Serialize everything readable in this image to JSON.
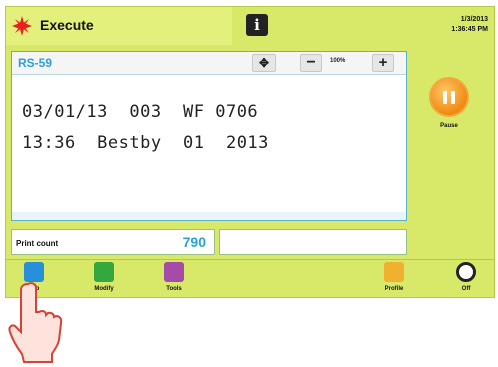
{
  "header": {
    "title": "Execute",
    "info_icon": "info-icon",
    "info_glyph": "i",
    "date": "1/3/2013",
    "time": "1:36:45 PM"
  },
  "editor": {
    "job_name": "RS-59",
    "zoom": "100%",
    "minus_glyph": "−",
    "plus_glyph": "+",
    "move_glyph": "✥",
    "message_lines": [
      "03/01/13  003  WF 0706",
      "13:36  Bestby  01  2013"
    ]
  },
  "pause": {
    "label": "Pause"
  },
  "print_count": {
    "label": "Print count",
    "value": "790"
  },
  "nav": [
    {
      "label": "Job",
      "icon": "job-icon"
    },
    {
      "label": "Modify",
      "icon": "modify-icon"
    },
    {
      "label": "Tools",
      "icon": "tools-icon"
    },
    {
      "label": "Profile",
      "icon": "profile-icon"
    },
    {
      "label": "Off",
      "icon": "power-off-icon"
    }
  ],
  "colors": {
    "background": "#d8e96a",
    "accent_blue": "#2c9fd8",
    "pause_orange": "#f08a10"
  }
}
